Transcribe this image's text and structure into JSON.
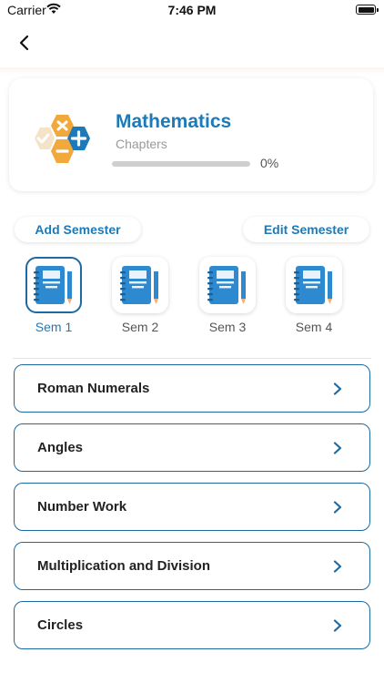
{
  "status_bar": {
    "carrier": "Carrier",
    "time": "7:46 PM"
  },
  "subject": {
    "title": "Mathematics",
    "subtitle": "Chapters",
    "progress_percent": 0,
    "progress_label": "0%"
  },
  "semester_actions": {
    "add_label": "Add Semester",
    "edit_label": "Edit Semester"
  },
  "semesters": [
    {
      "label": "Sem 1",
      "selected": true
    },
    {
      "label": "Sem 2",
      "selected": false
    },
    {
      "label": "Sem 3",
      "selected": false
    },
    {
      "label": "Sem 4",
      "selected": false
    }
  ],
  "chapters": [
    {
      "label": "Roman Numerals"
    },
    {
      "label": "Angles"
    },
    {
      "label": "Number Work"
    },
    {
      "label": "Multiplication and Division"
    },
    {
      "label": "Circles"
    }
  ],
  "icons": {
    "back": "chevron-left-icon",
    "semester": "notebook-icon",
    "chapter_arrow": "chevron-right-icon",
    "subject": "math-hexagon-logo"
  },
  "colors": {
    "accent": "#1d7ab8",
    "border": "#1d6aa3",
    "logo_orange": "#f2a93b",
    "logo_beige": "#f4e3c8"
  }
}
